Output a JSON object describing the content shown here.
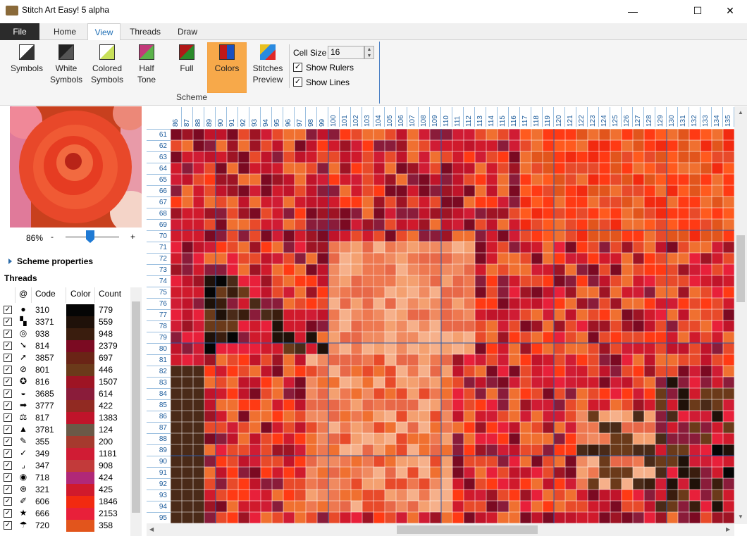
{
  "window": {
    "title": "Stitch Art Easy! 5 alpha",
    "minimize": "—",
    "maximize": "☐",
    "close": "✕"
  },
  "tabs": [
    {
      "label": "File"
    },
    {
      "label": "Home"
    },
    {
      "label": "View"
    },
    {
      "label": "Threads"
    },
    {
      "label": "Draw"
    }
  ],
  "active_tab": "View",
  "ribbon": {
    "buttons": [
      {
        "label1": "Symbols",
        "label2": "",
        "icon": "symbols-icon"
      },
      {
        "label1": "White",
        "label2": "Symbols",
        "icon": "white-symbols-icon"
      },
      {
        "label1": "Colored",
        "label2": "Symbols",
        "icon": "colored-symbols-icon"
      },
      {
        "label1": "Half",
        "label2": "Tone",
        "icon": "half-tone-icon"
      },
      {
        "label1": "Full",
        "label2": "",
        "icon": "full-icon"
      },
      {
        "label1": "Colors",
        "label2": "",
        "icon": "colors-icon"
      },
      {
        "label1": "Stitches",
        "label2": "Preview",
        "icon": "stitches-preview-icon"
      }
    ],
    "selected": "Colors",
    "group_label": "Scheme",
    "cell_size_label": "Cell Size",
    "cell_size_value": "16",
    "show_rulers_label": "Show Rulers",
    "show_rulers": true,
    "show_lines_label": "Show Lines",
    "show_lines": true
  },
  "left_panel": {
    "zoom_percent": "86%",
    "zoom_minus": "-",
    "zoom_plus": "+",
    "scheme_properties": "Scheme properties",
    "threads_heading": "Threads",
    "columns": {
      "symbol": "@",
      "code": "Code",
      "color": "Color",
      "count": "Count"
    },
    "threads": [
      {
        "symbol": "●",
        "code": "310",
        "color": "#050505",
        "count": "779"
      },
      {
        "symbol": "▚",
        "code": "3371",
        "color": "#1f1109",
        "count": "559"
      },
      {
        "symbol": "◎",
        "code": "938",
        "color": "#3a1d0e",
        "count": "948"
      },
      {
        "symbol": "➘",
        "code": "814",
        "color": "#7b0a22",
        "count": "2379"
      },
      {
        "symbol": "➚",
        "code": "3857",
        "color": "#6a2416",
        "count": "697"
      },
      {
        "symbol": "⊘",
        "code": "801",
        "color": "#6b3a1a",
        "count": "446"
      },
      {
        "symbol": "✪",
        "code": "816",
        "color": "#9e1424",
        "count": "1507"
      },
      {
        "symbol": "◒",
        "code": "3685",
        "color": "#8a1c3a",
        "count": "614"
      },
      {
        "symbol": "➡",
        "code": "3777",
        "color": "#912a22",
        "count": "422"
      },
      {
        "symbol": "⚖",
        "code": "817",
        "color": "#c0142a",
        "count": "1383"
      },
      {
        "symbol": "▲",
        "code": "3781",
        "color": "#6b5947",
        "count": "124"
      },
      {
        "symbol": "✎",
        "code": "355",
        "color": "#a63a2e",
        "count": "200"
      },
      {
        "symbol": "✓",
        "code": "349",
        "color": "#d01c34",
        "count": "1181"
      },
      {
        "symbol": "⌟",
        "code": "347",
        "color": "#c23a3a",
        "count": "908"
      },
      {
        "symbol": "◉",
        "code": "718",
        "color": "#b02878",
        "count": "424"
      },
      {
        "symbol": "⊛",
        "code": "321",
        "color": "#d01a2c",
        "count": "425"
      },
      {
        "symbol": "✐",
        "code": "606",
        "color": "#f22a10",
        "count": "1846"
      },
      {
        "symbol": "★",
        "code": "666",
        "color": "#e8203a",
        "count": "2153"
      },
      {
        "symbol": "☂",
        "code": "720",
        "color": "#e2551c",
        "count": "358"
      }
    ]
  },
  "canvas": {
    "col_start": 86,
    "col_end": 135,
    "row_start": 61,
    "row_end": 95,
    "ruler_color": "#1a5a9a"
  },
  "colors": {
    "accent": "#1f6fb5",
    "selected_button": "#f7a94a",
    "file_tab": "#2b2b2b"
  }
}
